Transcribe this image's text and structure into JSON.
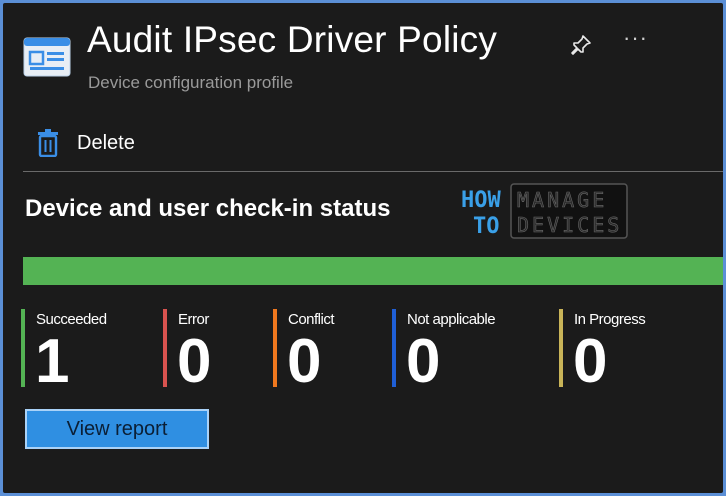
{
  "header": {
    "title": "Audit IPsec Driver Policy",
    "subtitle": "Device configuration profile",
    "icon": "profile-icon",
    "more_label": "···"
  },
  "toolbar": {
    "delete_label": "Delete",
    "delete_icon": "trash-icon"
  },
  "status": {
    "title": "Device and user check-in status",
    "progress_fraction": 1.0,
    "colors": {
      "progress": "#54b354"
    },
    "stats": [
      {
        "label": "Succeeded",
        "value": "1",
        "color": "#54b354"
      },
      {
        "label": "Error",
        "value": "0",
        "color": "#d9534f"
      },
      {
        "label": "Conflict",
        "value": "0",
        "color": "#f0781e"
      },
      {
        "label": "Not applicable",
        "value": "0",
        "color": "#1f5fd6"
      },
      {
        "label": "In Progress",
        "value": "0",
        "color": "#c9b458"
      }
    ],
    "view_report_label": "View report"
  },
  "watermark": {
    "logo": "HOW TO MANAGE DEVICES"
  }
}
